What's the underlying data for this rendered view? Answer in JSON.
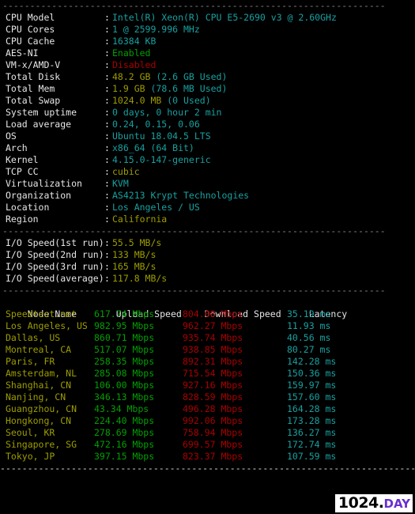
{
  "separators": {
    "dim": "----------------------------------------------------------------------",
    "bright": "-----------------------------------------------------------------------------------"
  },
  "system_info": {
    "rows": [
      {
        "label": "CPU Model",
        "colon": ":",
        "value": "Intel(R) Xeon(R) CPU E5-2690 v3 @ 2.60GHz",
        "color": "cyan"
      },
      {
        "label": "CPU Cores",
        "colon": ":",
        "value": "1 @ 2599.996 MHz",
        "color": "cyan"
      },
      {
        "label": "CPU Cache",
        "colon": ":",
        "value": "16384 KB",
        "color": "cyan"
      },
      {
        "label": "AES-NI",
        "colon": ":",
        "value": "Enabled",
        "color": "green"
      },
      {
        "label": "VM-x/AMD-V",
        "colon": ":",
        "value": "Disabled",
        "color": "red"
      },
      {
        "label": "Total Disk",
        "colon": ":",
        "value": "48.2 GB",
        "color": "olive",
        "suffix": " (2.6 GB Used)",
        "suffix_color": "cyan"
      },
      {
        "label": "Total Mem",
        "colon": ":",
        "value": "1.9 GB",
        "color": "olive",
        "suffix": " (78.6 MB Used)",
        "suffix_color": "cyan"
      },
      {
        "label": "Total Swap",
        "colon": ":",
        "value": "1024.0 MB",
        "color": "olive",
        "suffix": " (0 Used)",
        "suffix_color": "cyan"
      },
      {
        "label": "System uptime",
        "colon": ":",
        "value": "0 days, 0 hour 2 min",
        "color": "cyan"
      },
      {
        "label": "Load average",
        "colon": ":",
        "value": "0.24, 0.15, 0.06",
        "color": "cyan"
      },
      {
        "label": "OS",
        "colon": ":",
        "value": "Ubuntu 18.04.5 LTS",
        "color": "cyan"
      },
      {
        "label": "Arch",
        "colon": ":",
        "value": "x86_64 (64 Bit)",
        "color": "cyan"
      },
      {
        "label": "Kernel",
        "colon": ":",
        "value": "4.15.0-147-generic",
        "color": "cyan"
      },
      {
        "label": "TCP CC",
        "colon": ":",
        "value": "cubic",
        "color": "olive"
      },
      {
        "label": "Virtualization",
        "colon": ":",
        "value": "KVM",
        "color": "cyan"
      },
      {
        "label": "Organization",
        "colon": ":",
        "value": "AS4213 Krypt Technologies",
        "color": "cyan"
      },
      {
        "label": "Location",
        "colon": ":",
        "value": "Los Angeles / US",
        "color": "cyan"
      },
      {
        "label": "Region",
        "colon": ":",
        "value": "California",
        "color": "olive"
      }
    ]
  },
  "io_speed": {
    "rows": [
      {
        "label": "I/O Speed(1st run)",
        "colon": ":",
        "value": "55.5 MB/s",
        "color": "olive"
      },
      {
        "label": "I/O Speed(2nd run)",
        "colon": ":",
        "value": "133 MB/s",
        "color": "olive"
      },
      {
        "label": "I/O Speed(3rd run)",
        "colon": ":",
        "value": "165 MB/s",
        "color": "olive"
      },
      {
        "label": "I/O Speed(average)",
        "colon": ":",
        "value": "117.8 MB/s",
        "color": "olive"
      }
    ]
  },
  "speedtest": {
    "headers": {
      "node": "Node Name",
      "upload": "Upload Speed",
      "download": "Download Speed",
      "latency": "Latency"
    },
    "rows": [
      {
        "node": "Speedtest.net",
        "upload": "617.74 Mbps",
        "download": "804.08 Mbps",
        "latency": "35.19 ms"
      },
      {
        "node": "Los Angeles, US",
        "upload": "982.95 Mbps",
        "download": "962.27 Mbps",
        "latency": "11.93 ms"
      },
      {
        "node": "Dallas, US",
        "upload": "860.71 Mbps",
        "download": "935.74 Mbps",
        "latency": "40.56 ms"
      },
      {
        "node": "Montreal, CA",
        "upload": "517.07 Mbps",
        "download": "938.85 Mbps",
        "latency": "80.27 ms"
      },
      {
        "node": "Paris, FR",
        "upload": "258.35 Mbps",
        "download": "892.31 Mbps",
        "latency": "142.28 ms"
      },
      {
        "node": "Amsterdam, NL",
        "upload": "285.08 Mbps",
        "download": "715.54 Mbps",
        "latency": "150.36 ms"
      },
      {
        "node": "Shanghai, CN",
        "upload": "106.00 Mbps",
        "download": "927.16 Mbps",
        "latency": "159.97 ms"
      },
      {
        "node": "Nanjing, CN",
        "upload": "346.13 Mbps",
        "download": "828.59 Mbps",
        "latency": "157.60 ms"
      },
      {
        "node": "Guangzhou, CN",
        "upload": "43.34 Mbps",
        "download": "496.28 Mbps",
        "latency": "164.28 ms"
      },
      {
        "node": "Hongkong, CN",
        "upload": "224.40 Mbps",
        "download": "992.06 Mbps",
        "latency": "173.28 ms"
      },
      {
        "node": "Seoul, KR",
        "upload": "278.69 Mbps",
        "download": "758.94 Mbps",
        "latency": "136.27 ms"
      },
      {
        "node": "Singapore, SG",
        "upload": "472.16 Mbps",
        "download": "699.57 Mbps",
        "latency": "172.74 ms"
      },
      {
        "node": "Tokyo, JP",
        "upload": "397.15 Mbps",
        "download": "823.37 Mbps",
        "latency": "107.59 ms"
      }
    ]
  },
  "watermark": {
    "number": "1024.",
    "suffix": "DAY"
  },
  "colors": {
    "background": "#000000",
    "label": "#e6e6e6",
    "cyan": "#18a0a0",
    "olive": "#9d9d00",
    "green": "#00a000",
    "red": "#aa0000",
    "separator_dim": "#808080",
    "separator_bright": "#d9d9d9",
    "watermark_accent": "#6a2fd0"
  }
}
